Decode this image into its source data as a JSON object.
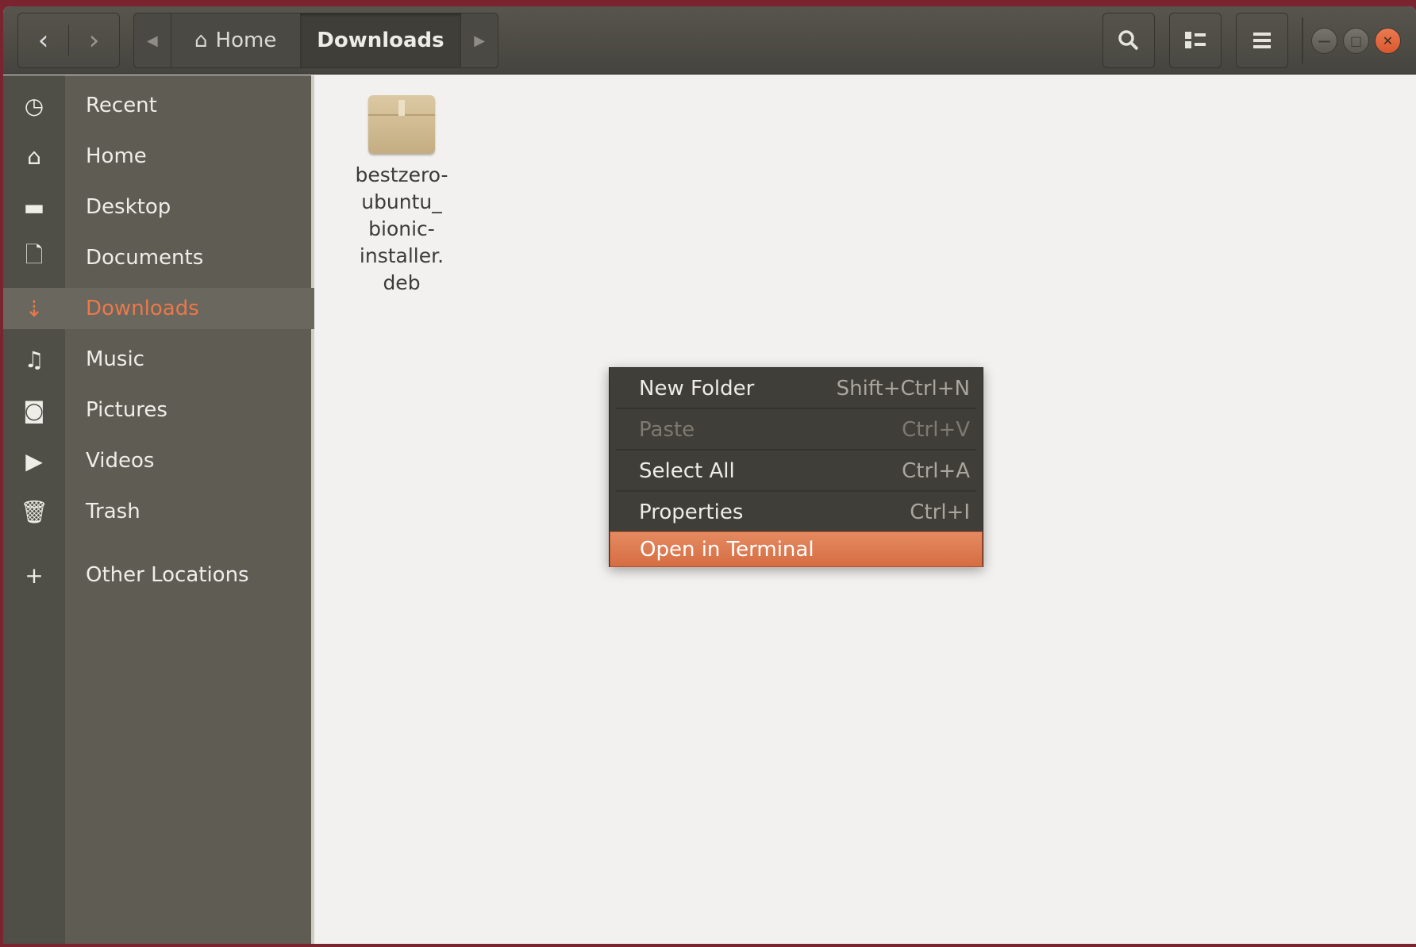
{
  "header": {
    "back_icon": "chevron-left",
    "forward_icon": "chevron-right",
    "path": [
      {
        "label": "Home",
        "icon": "home-icon"
      },
      {
        "label": "Downloads"
      }
    ],
    "buttons": [
      "search-icon",
      "view-toggle-icon",
      "hamburger-menu-icon"
    ],
    "window_controls": [
      "minimize",
      "maximize",
      "close"
    ]
  },
  "sidebar": {
    "items": [
      {
        "label": "Recent",
        "icon": "clock-icon"
      },
      {
        "label": "Home",
        "icon": "home-icon"
      },
      {
        "label": "Desktop",
        "icon": "folder-icon"
      },
      {
        "label": "Documents",
        "icon": "document-icon"
      },
      {
        "label": "Downloads",
        "icon": "download-icon",
        "selected": true
      },
      {
        "label": "Music",
        "icon": "music-icon"
      },
      {
        "label": "Pictures",
        "icon": "camera-icon"
      },
      {
        "label": "Videos",
        "icon": "video-icon"
      },
      {
        "label": "Trash",
        "icon": "trash-icon"
      },
      {
        "label": "Other Locations",
        "icon": "plus-icon"
      }
    ]
  },
  "files": [
    {
      "name": "bestzero-ubuntu_bionic-installer.deb",
      "lines": [
        "bestzero-",
        "ubuntu_",
        "bionic-",
        "installer.",
        "deb"
      ]
    }
  ],
  "context_menu": {
    "items": [
      {
        "label": "New Folder",
        "shortcut": "Shift+Ctrl+N"
      },
      {
        "label": "Paste",
        "shortcut": "Ctrl+V",
        "disabled": true
      },
      {
        "label": "Select All",
        "shortcut": "Ctrl+A"
      },
      {
        "label": "Properties",
        "shortcut": "Ctrl+I"
      },
      {
        "label": "Open in Terminal",
        "shortcut": "",
        "highlighted": true
      }
    ]
  },
  "colors": {
    "accent": "#e9794a",
    "highlight": "#e07e55",
    "sidebar": "#5f5c53"
  }
}
